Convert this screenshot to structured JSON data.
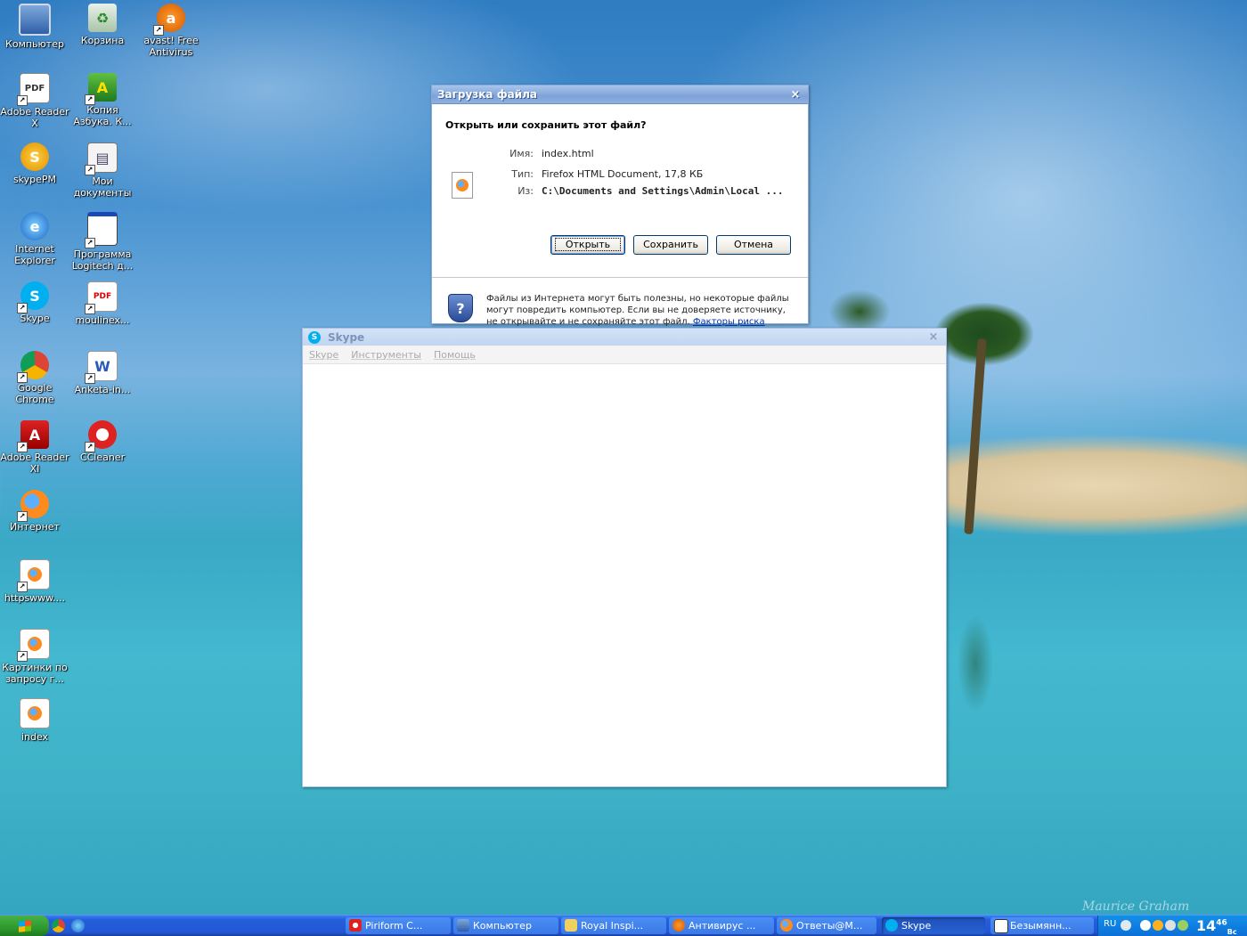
{
  "desktop": {
    "signature": "Maurice Graham",
    "icons": [
      {
        "label": "Компьютер",
        "icon": "computer-icon"
      },
      {
        "label": "Корзина",
        "icon": "recycle-bin-icon"
      },
      {
        "label": "avast! Free Antivirus",
        "icon": "avast-icon"
      },
      {
        "label": "Adobe Reader X",
        "icon": "adobe-reader-doc-icon"
      },
      {
        "label": "Копия Азбука. К...",
        "icon": "abc-app-icon"
      },
      {
        "label": "skypePM",
        "icon": "skypepm-icon"
      },
      {
        "label": "Мои документы",
        "icon": "my-documents-icon"
      },
      {
        "label": "Internet Explorer",
        "icon": "internet-explorer-icon"
      },
      {
        "label": "Программа Logitech д...",
        "icon": "logitech-program-icon"
      },
      {
        "label": "Skype",
        "icon": "skype-icon"
      },
      {
        "label": "moulinex...",
        "icon": "pdf-file-icon"
      },
      {
        "label": "Google Chrome",
        "icon": "chrome-icon"
      },
      {
        "label": "Anketa-in...",
        "icon": "word-file-icon"
      },
      {
        "label": "Adobe Reader XI",
        "icon": "adobe-acrobat-icon"
      },
      {
        "label": "CCleaner",
        "icon": "ccleaner-icon"
      },
      {
        "label": "Интернет",
        "icon": "firefox-icon"
      },
      {
        "label": "httpswww....",
        "icon": "firefox-html-file-icon"
      },
      {
        "label": "Картинки по запросу г...",
        "icon": "firefox-html-file-icon"
      },
      {
        "label": "index",
        "icon": "firefox-html-file-icon"
      }
    ]
  },
  "download_dialog": {
    "title": "Загрузка файла",
    "close": "×",
    "question": "Открыть или сохранить этот файл?",
    "name_label": "Имя:",
    "name_value": "index.html",
    "type_label": "Тип:",
    "type_value": "Firefox HTML Document, 17,8 КБ",
    "from_label": "Из:",
    "from_value": "C:\\Documents and Settings\\Admin\\Local ...",
    "open_button": "Открыть",
    "save_button": "Сохранить",
    "cancel_button": "Отмена",
    "warning_text": "Файлы из Интернета могут быть полезны, но некоторые файлы могут повредить компьютер. Если вы не доверяете источнику, не открывайте и не сохраняйте этот файл.",
    "risk_link": "Факторы риска"
  },
  "skype_window": {
    "title": "Skype",
    "close": "×",
    "menu": [
      "Skype",
      "Инструменты",
      "Помощь"
    ]
  },
  "taskbar": {
    "tasks": [
      {
        "label": "Piriform C...",
        "active": false
      },
      {
        "label": "Компьютер",
        "active": false
      },
      {
        "label": "Royal Inspi...",
        "active": false
      },
      {
        "label": "Антивирус ...",
        "active": false
      },
      {
        "label": "Ответы@M...",
        "active": false
      },
      {
        "label": "Skype",
        "active": true
      },
      {
        "label": "Безымянн...",
        "active": false
      }
    ],
    "language": "RU",
    "clock_hours": "14",
    "clock_minutes": "46",
    "clock_suffix": "Вс"
  },
  "colors": {
    "taskbar": "#245edb",
    "start_button": "#2e9a2e",
    "title_bar": "#7ea2d8",
    "skype_blue": "#00aff0"
  }
}
